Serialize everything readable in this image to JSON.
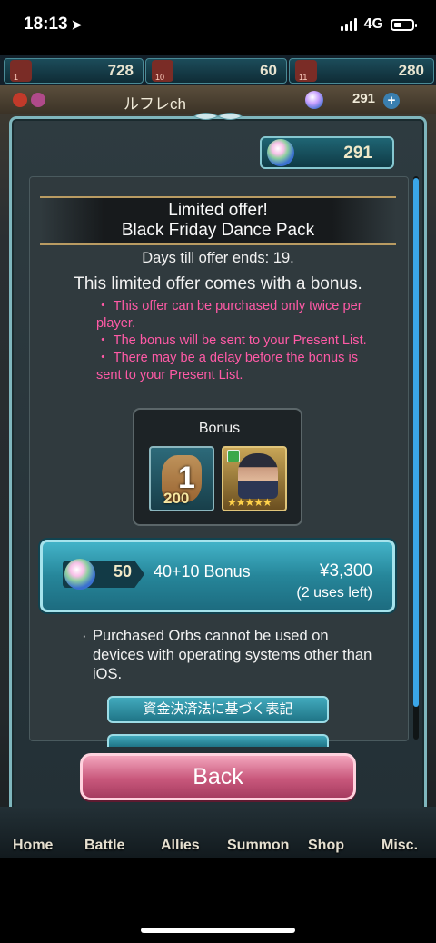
{
  "status_bar": {
    "time": "18:13",
    "network": "4G"
  },
  "resources": [
    {
      "icon": "flask-icon",
      "sub": "1",
      "value": "728"
    },
    {
      "icon": "flask-icon",
      "sub": "10",
      "value": "60"
    },
    {
      "icon": "flask-icon",
      "sub": "11",
      "value": "280"
    }
  ],
  "player": {
    "name": "ルフレch",
    "orbs": "291"
  },
  "orb_counter": {
    "value": "291"
  },
  "offer": {
    "title_line1": "Limited offer!",
    "title_line2": "Black Friday Dance Pack",
    "days_left": "Days till offer ends: 19.",
    "bonus_line": "This limited offer comes with a bonus.",
    "notes": [
      "・ This offer can be purchased only twice per player.",
      "・ The bonus will be sent to your Present List.",
      "・ There may be a delay before the bonus is sent to your Present List."
    ]
  },
  "bonus": {
    "title": "Bonus",
    "item1": {
      "count": "1",
      "amount": "200"
    },
    "item2": {
      "stars": "★★★★★"
    }
  },
  "purchase": {
    "orbs": "50",
    "bonus_text": "40+10 Bonus",
    "price": "¥3,300",
    "uses_left": "(2 uses left)"
  },
  "warning": {
    "bullet": "·",
    "text": "Purchased Orbs cannot be used on devices with operating systems other than iOS."
  },
  "legal_button": "資金決済法に基づく表記",
  "back_button": "Back",
  "nav": {
    "home": "Home",
    "battle": "Battle",
    "allies": "Allies",
    "summon": "Summon",
    "shop": "Shop",
    "misc": "Misc."
  },
  "colors": {
    "accent_teal": "#2b8ea3",
    "note_pink": "#ff5aa6",
    "back_pink": "#c9587c",
    "scroll_blue": "#3aa6e8"
  }
}
